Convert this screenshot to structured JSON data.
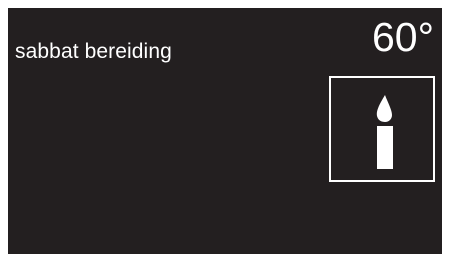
{
  "display": {
    "mode_label": "sabbat bereiding",
    "temperature": "60°",
    "mode_icon": "candle-icon"
  },
  "colors": {
    "screen_background": "#231f20",
    "foreground": "#ffffff"
  }
}
